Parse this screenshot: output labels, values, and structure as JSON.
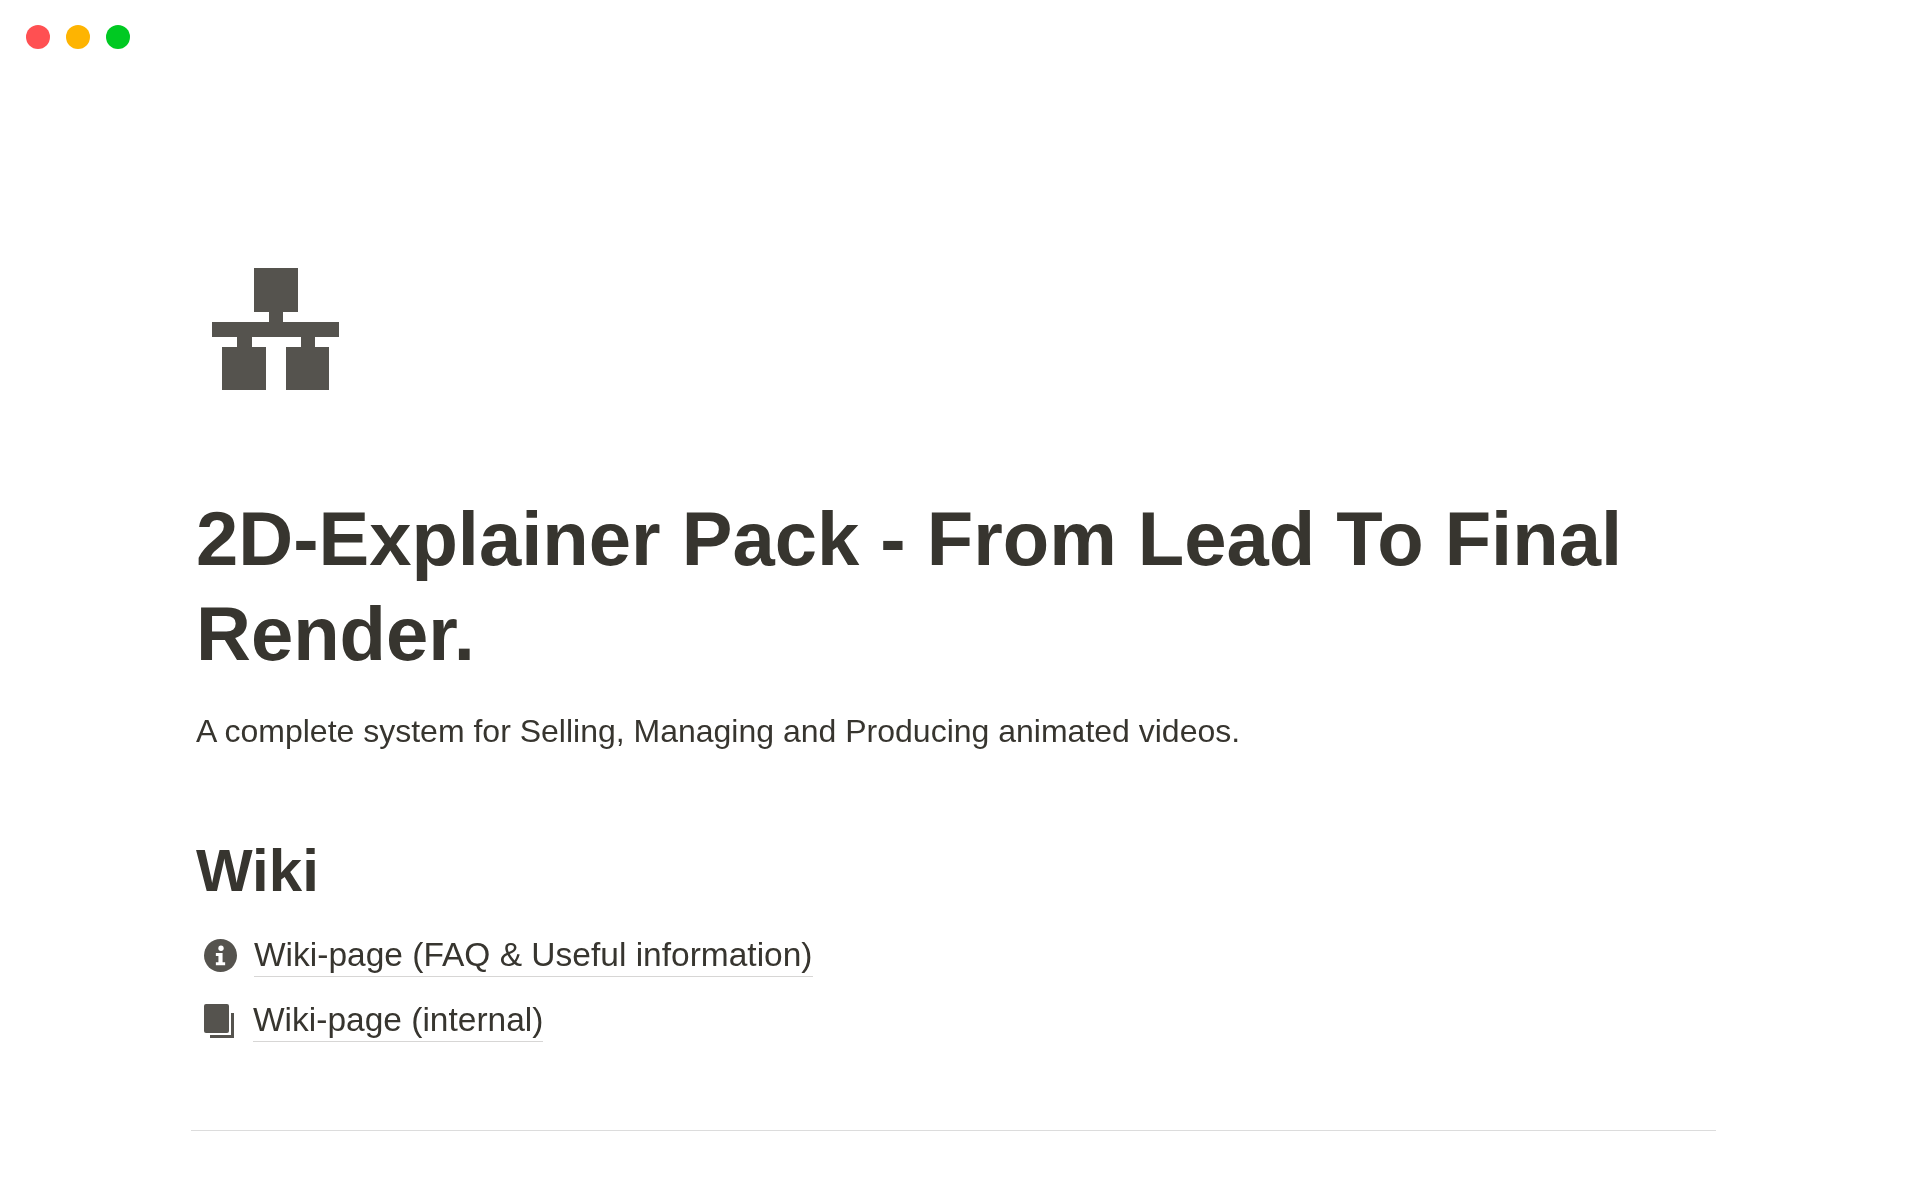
{
  "window": {
    "controls": [
      {
        "color": "#ff5052"
      },
      {
        "color": "#feb401"
      },
      {
        "color": "#00c922"
      }
    ]
  },
  "page": {
    "title": "2D-Explainer Pack - From Lead To Final Render.",
    "description": "A complete system for Selling, Managing and Producing animated videos.",
    "sections": [
      {
        "heading": "Wiki",
        "links": [
          {
            "kind": "info",
            "label": "Wiki-page (FAQ & Useful information)"
          },
          {
            "kind": "pages",
            "label": "Wiki-page (internal)"
          }
        ]
      }
    ]
  }
}
